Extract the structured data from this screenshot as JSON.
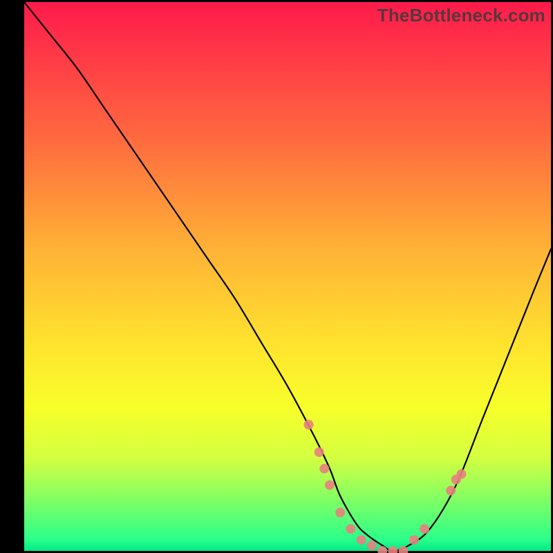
{
  "watermark": "TheBottleneck.com",
  "chart_data": {
    "type": "line",
    "title": "",
    "xlabel": "",
    "ylabel": "",
    "x_range": [
      0,
      100
    ],
    "y_range": [
      0,
      100
    ],
    "note": "Bottleneck-shaped curve over a red→yellow→green vertical gradient. Low y = good (green band at bottom). Axes are unlabeled; values are percent estimates relative to plot extents.",
    "series": [
      {
        "name": "bottleneck-curve",
        "color": "#000000",
        "x": [
          0,
          5,
          10,
          15,
          20,
          25,
          30,
          35,
          40,
          45,
          50,
          55,
          58,
          60,
          63,
          65,
          68,
          70,
          73,
          77,
          82,
          87,
          92,
          97,
          100
        ],
        "y": [
          100,
          94,
          88,
          81,
          74,
          67,
          60,
          53,
          46,
          38,
          30,
          21,
          15,
          10,
          5,
          3,
          1,
          0,
          1,
          4,
          12,
          24,
          36,
          48,
          55
        ]
      }
    ],
    "markers": {
      "name": "highlight-points",
      "color": "#e98080",
      "radius_px": 7,
      "x": [
        54,
        56,
        57,
        58,
        60,
        62,
        64,
        66,
        68,
        70,
        72,
        74,
        76,
        81,
        82,
        83
      ],
      "y": [
        23,
        18,
        15,
        12,
        7,
        4,
        2,
        1,
        0,
        0,
        0,
        2,
        4,
        11,
        13,
        14
      ]
    },
    "gradient_stops": [
      {
        "pos": 0.0,
        "color": "#ff1a4b"
      },
      {
        "pos": 0.1,
        "color": "#ff3a47"
      },
      {
        "pos": 0.25,
        "color": "#ff6a3f"
      },
      {
        "pos": 0.45,
        "color": "#ffb236"
      },
      {
        "pos": 0.62,
        "color": "#ffe22e"
      },
      {
        "pos": 0.74,
        "color": "#f7ff2a"
      },
      {
        "pos": 0.83,
        "color": "#d4ff40"
      },
      {
        "pos": 0.9,
        "color": "#88ff60"
      },
      {
        "pos": 0.98,
        "color": "#2aff8a"
      },
      {
        "pos": 1.0,
        "color": "#00e887"
      }
    ]
  }
}
